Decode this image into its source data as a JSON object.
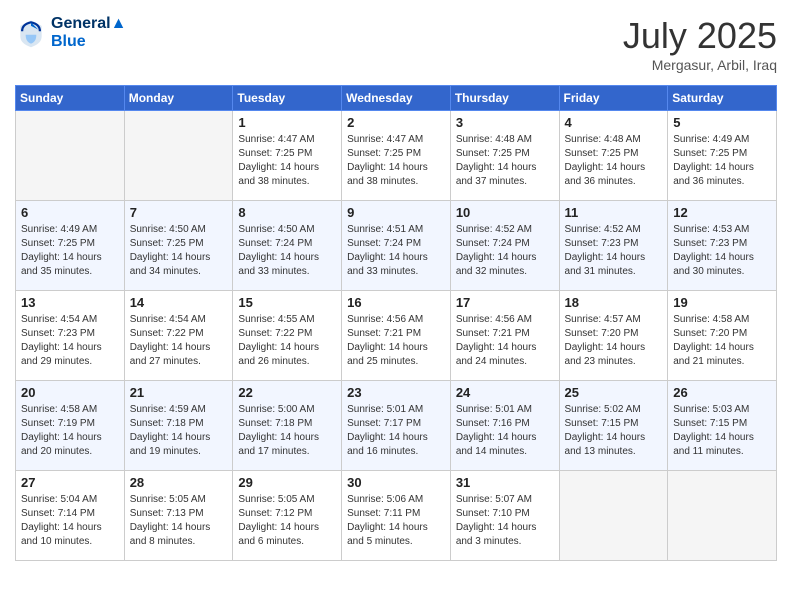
{
  "header": {
    "logo_line1": "General",
    "logo_line2": "Blue",
    "month_year": "July 2025",
    "location": "Mergasur, Arbil, Iraq"
  },
  "days_of_week": [
    "Sunday",
    "Monday",
    "Tuesday",
    "Wednesday",
    "Thursday",
    "Friday",
    "Saturday"
  ],
  "weeks": [
    [
      {
        "day": "",
        "empty": true
      },
      {
        "day": "",
        "empty": true
      },
      {
        "day": "1",
        "sunrise": "Sunrise: 4:47 AM",
        "sunset": "Sunset: 7:25 PM",
        "daylight": "Daylight: 14 hours and 38 minutes."
      },
      {
        "day": "2",
        "sunrise": "Sunrise: 4:47 AM",
        "sunset": "Sunset: 7:25 PM",
        "daylight": "Daylight: 14 hours and 38 minutes."
      },
      {
        "day": "3",
        "sunrise": "Sunrise: 4:48 AM",
        "sunset": "Sunset: 7:25 PM",
        "daylight": "Daylight: 14 hours and 37 minutes."
      },
      {
        "day": "4",
        "sunrise": "Sunrise: 4:48 AM",
        "sunset": "Sunset: 7:25 PM",
        "daylight": "Daylight: 14 hours and 36 minutes."
      },
      {
        "day": "5",
        "sunrise": "Sunrise: 4:49 AM",
        "sunset": "Sunset: 7:25 PM",
        "daylight": "Daylight: 14 hours and 36 minutes."
      }
    ],
    [
      {
        "day": "6",
        "sunrise": "Sunrise: 4:49 AM",
        "sunset": "Sunset: 7:25 PM",
        "daylight": "Daylight: 14 hours and 35 minutes."
      },
      {
        "day": "7",
        "sunrise": "Sunrise: 4:50 AM",
        "sunset": "Sunset: 7:25 PM",
        "daylight": "Daylight: 14 hours and 34 minutes."
      },
      {
        "day": "8",
        "sunrise": "Sunrise: 4:50 AM",
        "sunset": "Sunset: 7:24 PM",
        "daylight": "Daylight: 14 hours and 33 minutes."
      },
      {
        "day": "9",
        "sunrise": "Sunrise: 4:51 AM",
        "sunset": "Sunset: 7:24 PM",
        "daylight": "Daylight: 14 hours and 33 minutes."
      },
      {
        "day": "10",
        "sunrise": "Sunrise: 4:52 AM",
        "sunset": "Sunset: 7:24 PM",
        "daylight": "Daylight: 14 hours and 32 minutes."
      },
      {
        "day": "11",
        "sunrise": "Sunrise: 4:52 AM",
        "sunset": "Sunset: 7:23 PM",
        "daylight": "Daylight: 14 hours and 31 minutes."
      },
      {
        "day": "12",
        "sunrise": "Sunrise: 4:53 AM",
        "sunset": "Sunset: 7:23 PM",
        "daylight": "Daylight: 14 hours and 30 minutes."
      }
    ],
    [
      {
        "day": "13",
        "sunrise": "Sunrise: 4:54 AM",
        "sunset": "Sunset: 7:23 PM",
        "daylight": "Daylight: 14 hours and 29 minutes."
      },
      {
        "day": "14",
        "sunrise": "Sunrise: 4:54 AM",
        "sunset": "Sunset: 7:22 PM",
        "daylight": "Daylight: 14 hours and 27 minutes."
      },
      {
        "day": "15",
        "sunrise": "Sunrise: 4:55 AM",
        "sunset": "Sunset: 7:22 PM",
        "daylight": "Daylight: 14 hours and 26 minutes."
      },
      {
        "day": "16",
        "sunrise": "Sunrise: 4:56 AM",
        "sunset": "Sunset: 7:21 PM",
        "daylight": "Daylight: 14 hours and 25 minutes."
      },
      {
        "day": "17",
        "sunrise": "Sunrise: 4:56 AM",
        "sunset": "Sunset: 7:21 PM",
        "daylight": "Daylight: 14 hours and 24 minutes."
      },
      {
        "day": "18",
        "sunrise": "Sunrise: 4:57 AM",
        "sunset": "Sunset: 7:20 PM",
        "daylight": "Daylight: 14 hours and 23 minutes."
      },
      {
        "day": "19",
        "sunrise": "Sunrise: 4:58 AM",
        "sunset": "Sunset: 7:20 PM",
        "daylight": "Daylight: 14 hours and 21 minutes."
      }
    ],
    [
      {
        "day": "20",
        "sunrise": "Sunrise: 4:58 AM",
        "sunset": "Sunset: 7:19 PM",
        "daylight": "Daylight: 14 hours and 20 minutes."
      },
      {
        "day": "21",
        "sunrise": "Sunrise: 4:59 AM",
        "sunset": "Sunset: 7:18 PM",
        "daylight": "Daylight: 14 hours and 19 minutes."
      },
      {
        "day": "22",
        "sunrise": "Sunrise: 5:00 AM",
        "sunset": "Sunset: 7:18 PM",
        "daylight": "Daylight: 14 hours and 17 minutes."
      },
      {
        "day": "23",
        "sunrise": "Sunrise: 5:01 AM",
        "sunset": "Sunset: 7:17 PM",
        "daylight": "Daylight: 14 hours and 16 minutes."
      },
      {
        "day": "24",
        "sunrise": "Sunrise: 5:01 AM",
        "sunset": "Sunset: 7:16 PM",
        "daylight": "Daylight: 14 hours and 14 minutes."
      },
      {
        "day": "25",
        "sunrise": "Sunrise: 5:02 AM",
        "sunset": "Sunset: 7:15 PM",
        "daylight": "Daylight: 14 hours and 13 minutes."
      },
      {
        "day": "26",
        "sunrise": "Sunrise: 5:03 AM",
        "sunset": "Sunset: 7:15 PM",
        "daylight": "Daylight: 14 hours and 11 minutes."
      }
    ],
    [
      {
        "day": "27",
        "sunrise": "Sunrise: 5:04 AM",
        "sunset": "Sunset: 7:14 PM",
        "daylight": "Daylight: 14 hours and 10 minutes."
      },
      {
        "day": "28",
        "sunrise": "Sunrise: 5:05 AM",
        "sunset": "Sunset: 7:13 PM",
        "daylight": "Daylight: 14 hours and 8 minutes."
      },
      {
        "day": "29",
        "sunrise": "Sunrise: 5:05 AM",
        "sunset": "Sunset: 7:12 PM",
        "daylight": "Daylight: 14 hours and 6 minutes."
      },
      {
        "day": "30",
        "sunrise": "Sunrise: 5:06 AM",
        "sunset": "Sunset: 7:11 PM",
        "daylight": "Daylight: 14 hours and 5 minutes."
      },
      {
        "day": "31",
        "sunrise": "Sunrise: 5:07 AM",
        "sunset": "Sunset: 7:10 PM",
        "daylight": "Daylight: 14 hours and 3 minutes."
      },
      {
        "day": "",
        "empty": true
      },
      {
        "day": "",
        "empty": true
      }
    ]
  ]
}
